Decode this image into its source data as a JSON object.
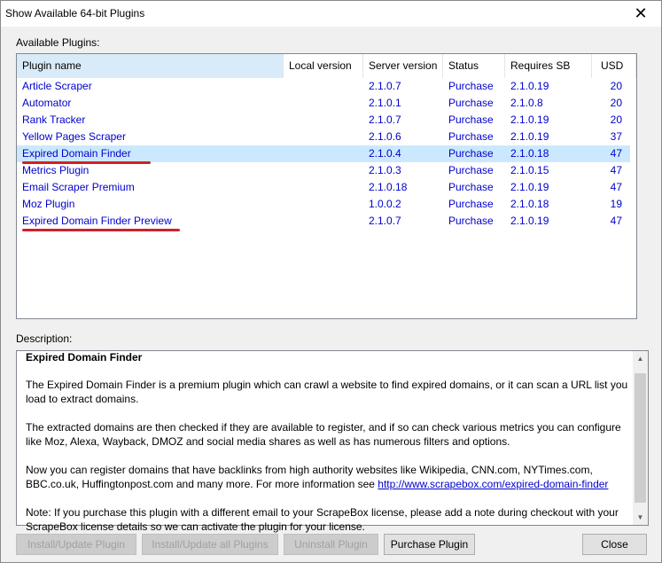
{
  "window": {
    "title": "Show Available 64-bit Plugins",
    "close_glyph": "✕"
  },
  "labels": {
    "available_plugins": "Available Plugins:",
    "description": "Description:"
  },
  "table": {
    "columns": [
      "Plugin name",
      "Local version",
      "Server version",
      "Status",
      "Requires SB",
      "USD"
    ],
    "rows": [
      {
        "name": "Article Scraper",
        "local": "",
        "server": "2.1.0.7",
        "status": "Purchase",
        "requires": "2.1.0.19",
        "usd": "20"
      },
      {
        "name": "Automator",
        "local": "",
        "server": "2.1.0.1",
        "status": "Purchase",
        "requires": "2.1.0.8",
        "usd": "20"
      },
      {
        "name": "Rank Tracker",
        "local": "",
        "server": "2.1.0.7",
        "status": "Purchase",
        "requires": "2.1.0.19",
        "usd": "20"
      },
      {
        "name": "Yellow Pages Scraper",
        "local": "",
        "server": "2.1.0.6",
        "status": "Purchase",
        "requires": "2.1.0.19",
        "usd": "37"
      },
      {
        "name": "Expired Domain Finder",
        "local": "",
        "server": "2.1.0.4",
        "status": "Purchase",
        "requires": "2.1.0.18",
        "usd": "47"
      },
      {
        "name": "Metrics Plugin",
        "local": "",
        "server": "2.1.0.3",
        "status": "Purchase",
        "requires": "2.1.0.15",
        "usd": "47"
      },
      {
        "name": "Email Scraper Premium",
        "local": "",
        "server": "2.1.0.18",
        "status": "Purchase",
        "requires": "2.1.0.19",
        "usd": "47"
      },
      {
        "name": "Moz Plugin",
        "local": "",
        "server": "1.0.0.2",
        "status": "Purchase",
        "requires": "2.1.0.18",
        "usd": "19"
      },
      {
        "name": "Expired Domain Finder Preview",
        "local": "",
        "server": "2.1.0.7",
        "status": "Purchase",
        "requires": "2.1.0.19",
        "usd": "47"
      }
    ],
    "selected_row": 4
  },
  "description": {
    "heading": "Expired Domain Finder",
    "p1": "The Expired Domain Finder is a premium plugin which can crawl a website to find expired domains, or it can scan a URL list you load to extract domains.",
    "p2": "The extracted domains are then checked if they are available to register, and if so can check various metrics you can configure like Moz, Alexa, Wayback, DMOZ and social media shares as well as has numerous filters and options.",
    "p3_text": "Now you can register domains that have backlinks from high authority websites like Wikipedia, CNN.com, NYTimes.com, BBC.co.uk, Huffingtonpost.com and many more. For more information see ",
    "p3_link": "http://www.scrapebox.com/expired-domain-finder",
    "p4": "Note: If you purchase this plugin with a different email to your ScrapeBox license, please add a note during checkout with your ScrapeBox license details so we can activate the plugin for your license."
  },
  "buttons": {
    "install_update": "Install/Update Plugin",
    "install_update_all": "Install/Update all Plugins",
    "uninstall": "Uninstall Plugin",
    "purchase": "Purchase Plugin",
    "close": "Close"
  },
  "colors": {
    "link_blue": "#0000cc",
    "selected_row": "#cce8ff",
    "annotation_red": "#d0202a"
  }
}
